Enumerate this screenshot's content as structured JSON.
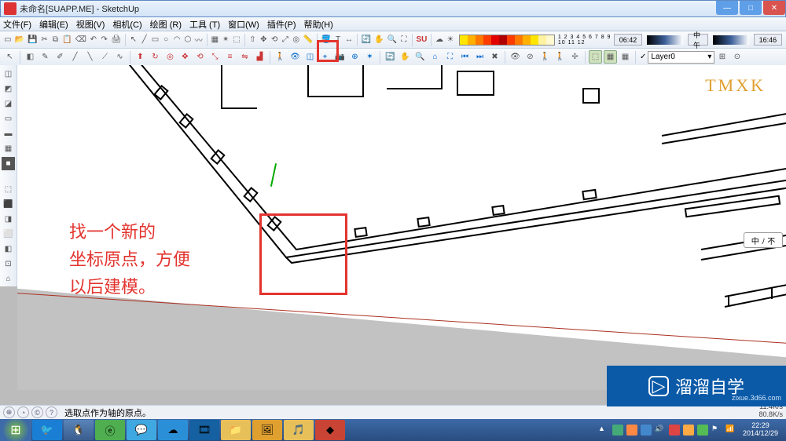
{
  "titlebar": {
    "title": "未命名[SUAPP.ME] - SketchUp"
  },
  "menu": {
    "file": "文件(F)",
    "edit": "编辑(E)",
    "view": "视图(V)",
    "camera": "相机(C)",
    "draw": "绘图 (R)",
    "tools": "工具 (T)",
    "window": "窗口(W)",
    "plugins": "插件(P)",
    "help": "帮助(H)"
  },
  "toolbar1": {
    "scale_labels": "1 2 3 4 5 6 7 8 9 10 11 12",
    "time_from": "06:42",
    "time_label": "中午",
    "time_to": "16:46"
  },
  "layer": {
    "current": "Layer0"
  },
  "annotation": {
    "line1": "找一个新的",
    "line2": "坐标原点，方便",
    "line3": "以后建模。"
  },
  "status": {
    "hint": "选取点作为轴的原点。"
  },
  "viewcube": {
    "labels": "中 ﾉ 不"
  },
  "watermark": {
    "tmxk": "TMXK",
    "brand": "溜溜自学",
    "url": "zixue.3d66.com"
  },
  "net": {
    "down": "11.4K/s",
    "up": "80.8K/s"
  },
  "clock": {
    "time": "22:29",
    "date": "2014/12/29"
  },
  "icons": {
    "win_min": "—",
    "win_max": "□",
    "win_close": "✕",
    "start": "⊞"
  }
}
